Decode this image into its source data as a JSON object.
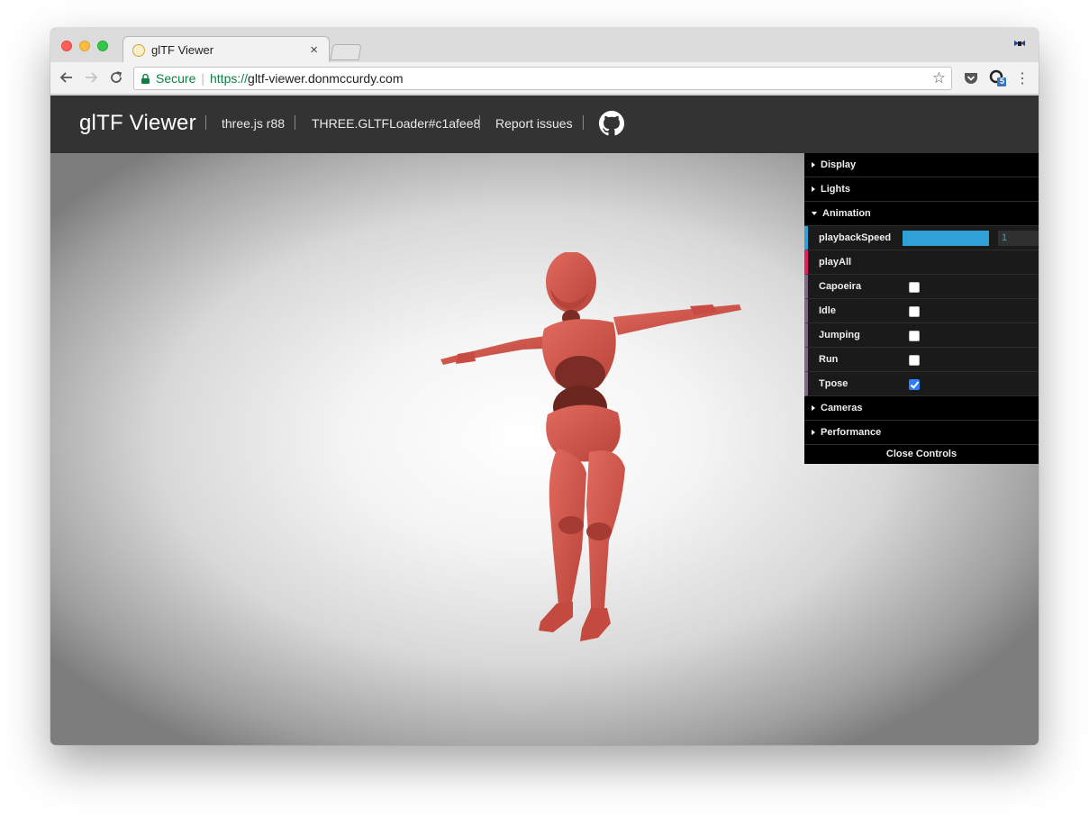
{
  "browser": {
    "tab_title": "glTF Viewer",
    "tab_close": "×",
    "secure_label": "Secure",
    "url_scheme": "https://",
    "url_host": "gltf-viewer.donmccurdy.com",
    "ext_badge": "5"
  },
  "header": {
    "brand": "glTF Viewer",
    "links": [
      "three.js r88",
      "THREE.GLTFLoader#c1afee8",
      "Report issues"
    ]
  },
  "gui": {
    "folders_top": [
      "Display",
      "Lights"
    ],
    "animation_folder": "Animation",
    "playback_label": "playbackSpeed",
    "playback_value": "1",
    "playback_fraction": 1.0,
    "playall_label": "playAll",
    "clips": [
      {
        "label": "Capoeira",
        "checked": false
      },
      {
        "label": "Idle",
        "checked": false
      },
      {
        "label": "Jumping",
        "checked": false
      },
      {
        "label": "Run",
        "checked": false
      },
      {
        "label": "Tpose",
        "checked": true
      }
    ],
    "folders_bottom": [
      "Cameras",
      "Performance"
    ],
    "close_label": "Close Controls"
  },
  "colors": {
    "model": "#d4564c",
    "slider": "#2fa1d6",
    "header_bg": "#333333"
  }
}
